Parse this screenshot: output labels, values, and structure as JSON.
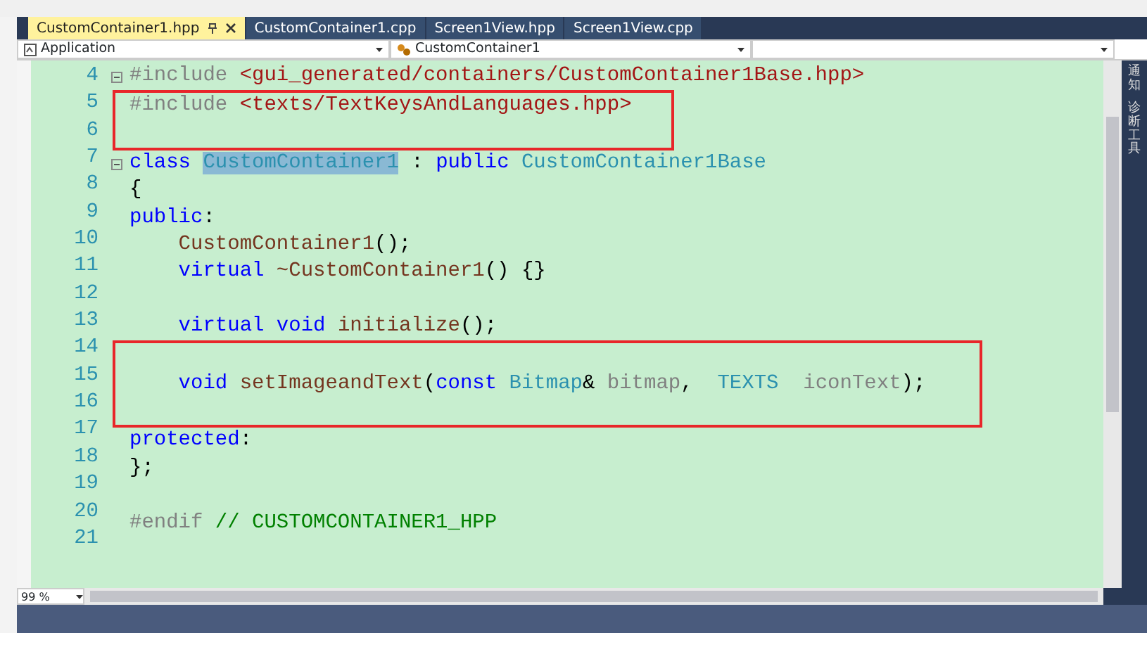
{
  "tabs": [
    {
      "label": "CustomContainer1.hpp",
      "selected": true
    },
    {
      "label": "CustomContainer1.cpp",
      "selected": false
    },
    {
      "label": "Screen1View.hpp",
      "selected": false
    },
    {
      "label": "Screen1View.cpp",
      "selected": false
    }
  ],
  "nav_bar": {
    "project": "Application",
    "scope": "CustomContainer1"
  },
  "side_panel": [
    "通知",
    "诊断工具"
  ],
  "blocks": [
    {
      "boxed": false,
      "lines": [
        {
          "number": "4",
          "fold": true,
          "tokens": [
            {
              "text": "#include ",
              "kind": "pre"
            },
            {
              "text": "<gui_generated/containers/CustomContainer1Base.hpp>",
              "kind": "str"
            }
          ]
        }
      ]
    },
    {
      "boxed": true,
      "lines": [
        {
          "number": "5",
          "fold": false,
          "tokens": [
            {
              "text": "#include ",
              "kind": "pre"
            },
            {
              "text": "<texts/TextKeysAndLanguages.hpp>",
              "kind": "str"
            }
          ]
        },
        {
          "number": "6",
          "fold": false
        }
      ]
    },
    {
      "boxed": false,
      "lines": [
        {
          "number": "7",
          "fold": true,
          "tokens": [
            {
              "text": "class ",
              "kind": "kw"
            },
            {
              "text": "CustomContainer1",
              "kind": "selected-type"
            },
            {
              "text": " : ",
              "kind": "plain"
            },
            {
              "text": "public ",
              "kind": "kw"
            },
            {
              "text": "CustomContainer1Base",
              "kind": "type"
            }
          ]
        },
        {
          "number": "8",
          "fold": false,
          "tokens": [
            {
              "text": "{",
              "kind": "plain"
            }
          ]
        },
        {
          "number": "9",
          "fold": false,
          "tokens": [
            {
              "text": "public",
              "kind": "kw"
            },
            {
              "text": ":",
              "kind": "plain"
            }
          ]
        },
        {
          "number": "10",
          "fold": false,
          "tokens": [
            {
              "text": "    CustomContainer1",
              "kind": "fn"
            },
            {
              "text": "();",
              "kind": "plain"
            }
          ]
        },
        {
          "number": "11",
          "fold": false,
          "tokens": [
            {
              "text": "    virtual ",
              "kind": "kw"
            },
            {
              "text": "~CustomContainer1",
              "kind": "fn"
            },
            {
              "text": "() {}",
              "kind": "plain"
            }
          ]
        },
        {
          "number": "12",
          "fold": false
        },
        {
          "number": "13",
          "fold": false,
          "tokens": [
            {
              "text": "    virtual void ",
              "kind": "kw"
            },
            {
              "text": "initialize",
              "kind": "fn"
            },
            {
              "text": "();",
              "kind": "plain"
            }
          ]
        }
      ]
    },
    {
      "boxed": true,
      "lines": [
        {
          "number": "14",
          "fold": false
        },
        {
          "number": "15",
          "fold": false,
          "tokens": [
            {
              "text": "    void ",
              "kind": "kw"
            },
            {
              "text": "setImageandText",
              "kind": "fn"
            },
            {
              "text": "(",
              "kind": "plain"
            },
            {
              "text": "const ",
              "kind": "kw"
            },
            {
              "text": "Bitmap",
              "kind": "type"
            },
            {
              "text": "& ",
              "kind": "plain"
            },
            {
              "text": "bitmap",
              "kind": "param"
            },
            {
              "text": ",  ",
              "kind": "plain"
            },
            {
              "text": "TEXTS",
              "kind": "type"
            },
            {
              "text": "  iconText",
              "kind": "param"
            },
            {
              "text": ");",
              "kind": "plain"
            }
          ]
        },
        {
          "number": "16",
          "fold": false
        }
      ]
    },
    {
      "boxed": false,
      "lines": [
        {
          "number": "17",
          "fold": false,
          "tokens": [
            {
              "text": "protected",
              "kind": "kw"
            },
            {
              "text": ":",
              "kind": "plain"
            }
          ]
        },
        {
          "number": "18",
          "fold": false,
          "tokens": [
            {
              "text": "};",
              "kind": "plain"
            }
          ]
        },
        {
          "number": "19",
          "fold": false
        },
        {
          "number": "20",
          "fold": false,
          "tokens": [
            {
              "text": "#endif ",
              "kind": "pre"
            },
            {
              "text": "// CUSTOMCONTAINER1_HPP",
              "kind": "comment"
            }
          ]
        },
        {
          "number": "21",
          "fold": false
        }
      ]
    }
  ],
  "zoom": "99 %"
}
